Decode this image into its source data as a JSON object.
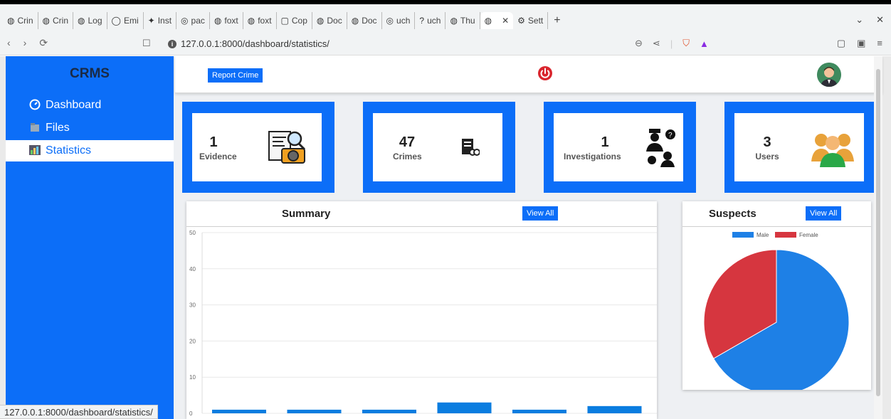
{
  "browser": {
    "tabs": [
      "Crin",
      "Crin",
      "Log",
      "Emi",
      "Inst",
      "pac",
      "foxt",
      "foxt",
      "Cop",
      "Doc",
      "Doc",
      "uch",
      "uch",
      "Thu",
      "",
      "Sett"
    ],
    "new_tab": "+",
    "url": "127.0.0.1:8000/dashboard/statistics/",
    "status_url": "127.0.0.1:8000/dashboard/statistics/"
  },
  "sidebar": {
    "brand": "CRMS",
    "items": [
      {
        "label": "Dashboard",
        "icon": "gauge-icon"
      },
      {
        "label": "Files",
        "icon": "folder-icon"
      },
      {
        "label": "Statistics",
        "icon": "chart-icon"
      }
    ]
  },
  "topbar": {
    "report_label": "Report Crime"
  },
  "cards": [
    {
      "count": "1",
      "label": "Evidence",
      "icon": "evidence-icon"
    },
    {
      "count": "47",
      "label": "Crimes",
      "icon": "crimes-icon"
    },
    {
      "count": "1",
      "label": "Investigations",
      "icon": "police-icon"
    },
    {
      "count": "3",
      "label": "Users",
      "icon": "users-icon"
    }
  ],
  "summary": {
    "title": "Summary",
    "view_all": "View All"
  },
  "suspects": {
    "title": "Suspects",
    "view_all": "View All"
  },
  "colors": {
    "primary": "#0c6ef8",
    "bar": "#0a7de0",
    "male": "#1e80e6",
    "female": "#d6363f"
  },
  "chart_data": [
    {
      "type": "bar",
      "title": "",
      "yticks": [
        0,
        10,
        20,
        30,
        40,
        50
      ],
      "ylim": [
        0,
        50
      ],
      "values": [
        1,
        1,
        1,
        3,
        1,
        2
      ],
      "grid": true
    },
    {
      "type": "pie",
      "title": "",
      "legend_position": "top",
      "series": [
        {
          "name": "Male",
          "value": 2
        },
        {
          "name": "Female",
          "value": 1
        }
      ]
    }
  ]
}
